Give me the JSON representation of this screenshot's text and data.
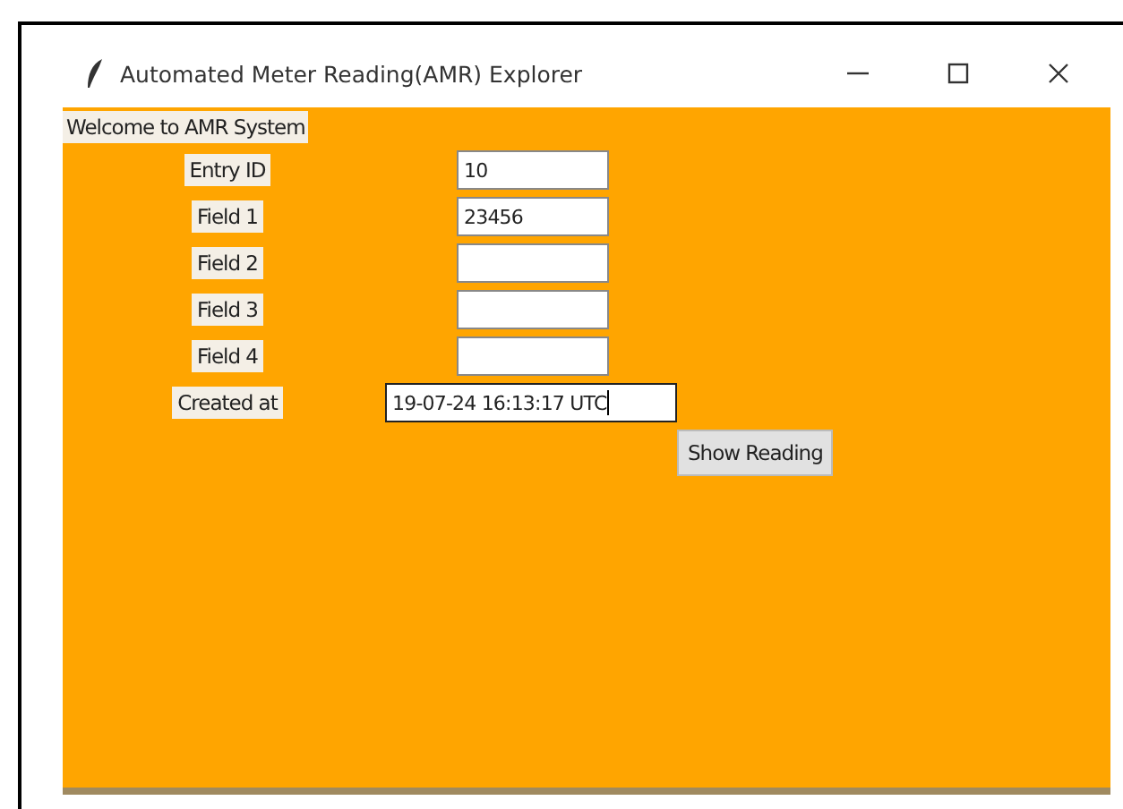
{
  "window": {
    "title": "Automated Meter Reading(AMR) Explorer"
  },
  "welcome": "Welcome to AMR System",
  "fields": [
    {
      "label": "Entry ID",
      "value": "10",
      "kind": "short",
      "focused": false
    },
    {
      "label": "Field 1",
      "value": "23456",
      "kind": "short",
      "focused": false
    },
    {
      "label": "Field 2",
      "kind": "short",
      "focused": false
    },
    {
      "label": "Field 3",
      "kind": "short",
      "focused": false
    },
    {
      "label": "Field 4",
      "kind": "short",
      "focused": false
    },
    {
      "label": "Created at",
      "value": "19-07-24 16:13:17 UTC",
      "kind": "wide",
      "focused": true
    }
  ],
  "button": "Show Reading"
}
